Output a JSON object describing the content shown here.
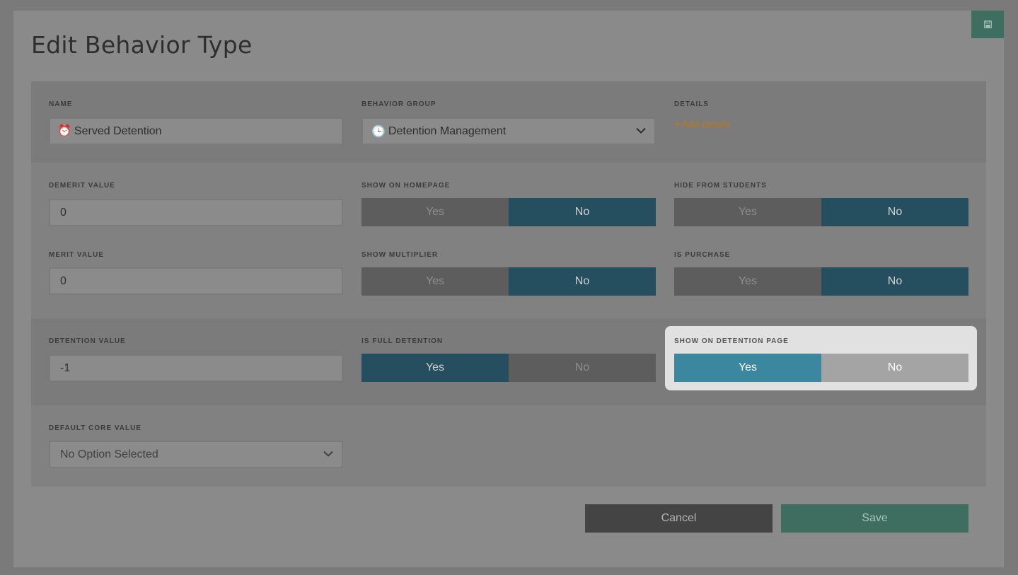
{
  "header": {
    "title": "Edit Behavior Type",
    "save_icon": "floppy-disk-icon"
  },
  "colors": {
    "accent": "#3a879f",
    "toggle_on": "#254f5f",
    "save": "#3d6e5f",
    "link": "#b57a20"
  },
  "name": {
    "label": "NAME",
    "emoji": "⏰",
    "value": "Served Detention"
  },
  "behavior_group": {
    "label": "BEHAVIOR GROUP",
    "emoji": "🕒",
    "value": "Detention Management"
  },
  "details": {
    "label": "DETAILS",
    "plus": "+",
    "link": "Add details"
  },
  "demerit_value": {
    "label": "DEMERIT VALUE",
    "value": "0"
  },
  "merit_value": {
    "label": "MERIT VALUE",
    "value": "0"
  },
  "detention_value": {
    "label": "DETENTION VALUE",
    "value": "-1"
  },
  "toggles": {
    "yes": "Yes",
    "no": "No",
    "show_on_homepage": {
      "label": "SHOW ON HOMEPAGE",
      "selected": "No"
    },
    "hide_from_students": {
      "label": "HIDE FROM STUDENTS",
      "selected": "No"
    },
    "show_multiplier": {
      "label": "SHOW MULTIPLIER",
      "selected": "No"
    },
    "is_purchase": {
      "label": "IS PURCHASE",
      "selected": "No"
    },
    "is_full_detention": {
      "label": "IS FULL DETENTION",
      "selected": "Yes"
    },
    "show_on_detention_page": {
      "label": "SHOW ON DETENTION PAGE",
      "selected": "Yes"
    }
  },
  "default_core_value": {
    "label": "DEFAULT CORE VALUE",
    "placeholder": "No Option Selected"
  },
  "footer": {
    "cancel": "Cancel",
    "save": "Save"
  }
}
